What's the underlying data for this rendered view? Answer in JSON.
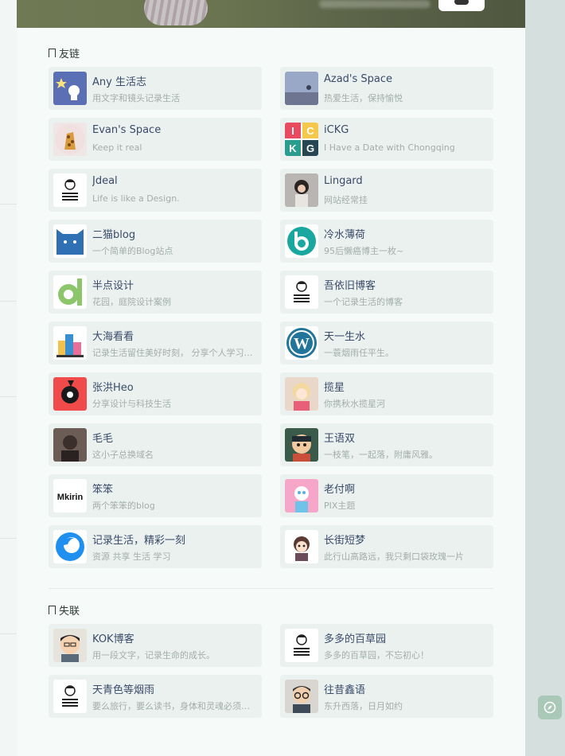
{
  "sections": {
    "friends_title": "友链",
    "lost_title": "失联"
  },
  "friends": [
    {
      "name": "Any 生活志",
      "desc": "用文字和镜头记录生活",
      "avatar": "star-rocket-icon"
    },
    {
      "name": "Azad's Space",
      "desc": "热爱生活，保持愉悦",
      "avatar": "sky-photo-icon"
    },
    {
      "name": "Evan's Space",
      "desc": "Keep it real",
      "avatar": "giraffe-icon"
    },
    {
      "name": "iCKG",
      "desc": "I Have a Date with Chongqing",
      "avatar": "ickg-logo-icon"
    },
    {
      "name": "Jdeal",
      "desc": "Life is like a Design.",
      "avatar": "striped-person-icon"
    },
    {
      "name": "Lingard",
      "desc": "网站经常挂",
      "avatar": "girl-photo-icon"
    },
    {
      "name": "二猫blog",
      "desc": "一个简单的Blog站点",
      "avatar": "cat-icon"
    },
    {
      "name": "冷水薄荷",
      "desc": "95后懒癌博主一枚~",
      "avatar": "teal-logo-icon"
    },
    {
      "name": "半点设计",
      "desc": "花园，庭院设计案例",
      "avatar": "green-d-logo-icon"
    },
    {
      "name": "吾依旧博客",
      "desc": "一个记录生活的博客",
      "avatar": "striped-person-icon"
    },
    {
      "name": "大海看看",
      "desc": "记录生活留住美好时刻， 分享个人学习与生活",
      "avatar": "buildings-icon"
    },
    {
      "name": "天一生水",
      "desc": "一蓑烟雨任平生。",
      "avatar": "wordpress-icon"
    },
    {
      "name": "张洪Heo",
      "desc": "分享设计与科技生活",
      "avatar": "heo-logo-icon"
    },
    {
      "name": "揽星",
      "desc": "你携秋水揽星河",
      "avatar": "anime-girl-icon"
    },
    {
      "name": "毛毛",
      "desc": "这小子总换域名",
      "avatar": "dark-portrait-icon"
    },
    {
      "name": "王语双",
      "desc": "一枝笔，一起落，附庸风雅。",
      "avatar": "cartoon-boy-icon"
    },
    {
      "name": "笨笨",
      "desc": "两个笨笨的blog",
      "avatar": "mkirin-logo-icon"
    },
    {
      "name": "老付啊",
      "desc": "PIX主题",
      "avatar": "pink-cartoon-icon"
    },
    {
      "name": "记录生活，精彩一刻",
      "desc": "资源 共享 生活 学习",
      "avatar": "firefox-icon"
    },
    {
      "name": "长街短梦",
      "desc": "此行山高路远，我只剩口袋玫瑰一片",
      "avatar": "chibi-girl-icon"
    }
  ],
  "lost": [
    {
      "name": "KOK博客",
      "desc": "用一段文字，记录生命的成长。",
      "avatar": "cartoon-man-icon"
    },
    {
      "name": "多多的百草园",
      "desc": "多多的百草园，不忘初心！",
      "avatar": "striped-person-icon"
    },
    {
      "name": "天青色等烟雨",
      "desc": "要么旅行，要么读书，身体和灵魂必须有一个在路上",
      "avatar": "striped-person-icon"
    },
    {
      "name": "往昔鑫语",
      "desc": "东升西落，日月如约",
      "avatar": "glasses-man-icon"
    }
  ]
}
